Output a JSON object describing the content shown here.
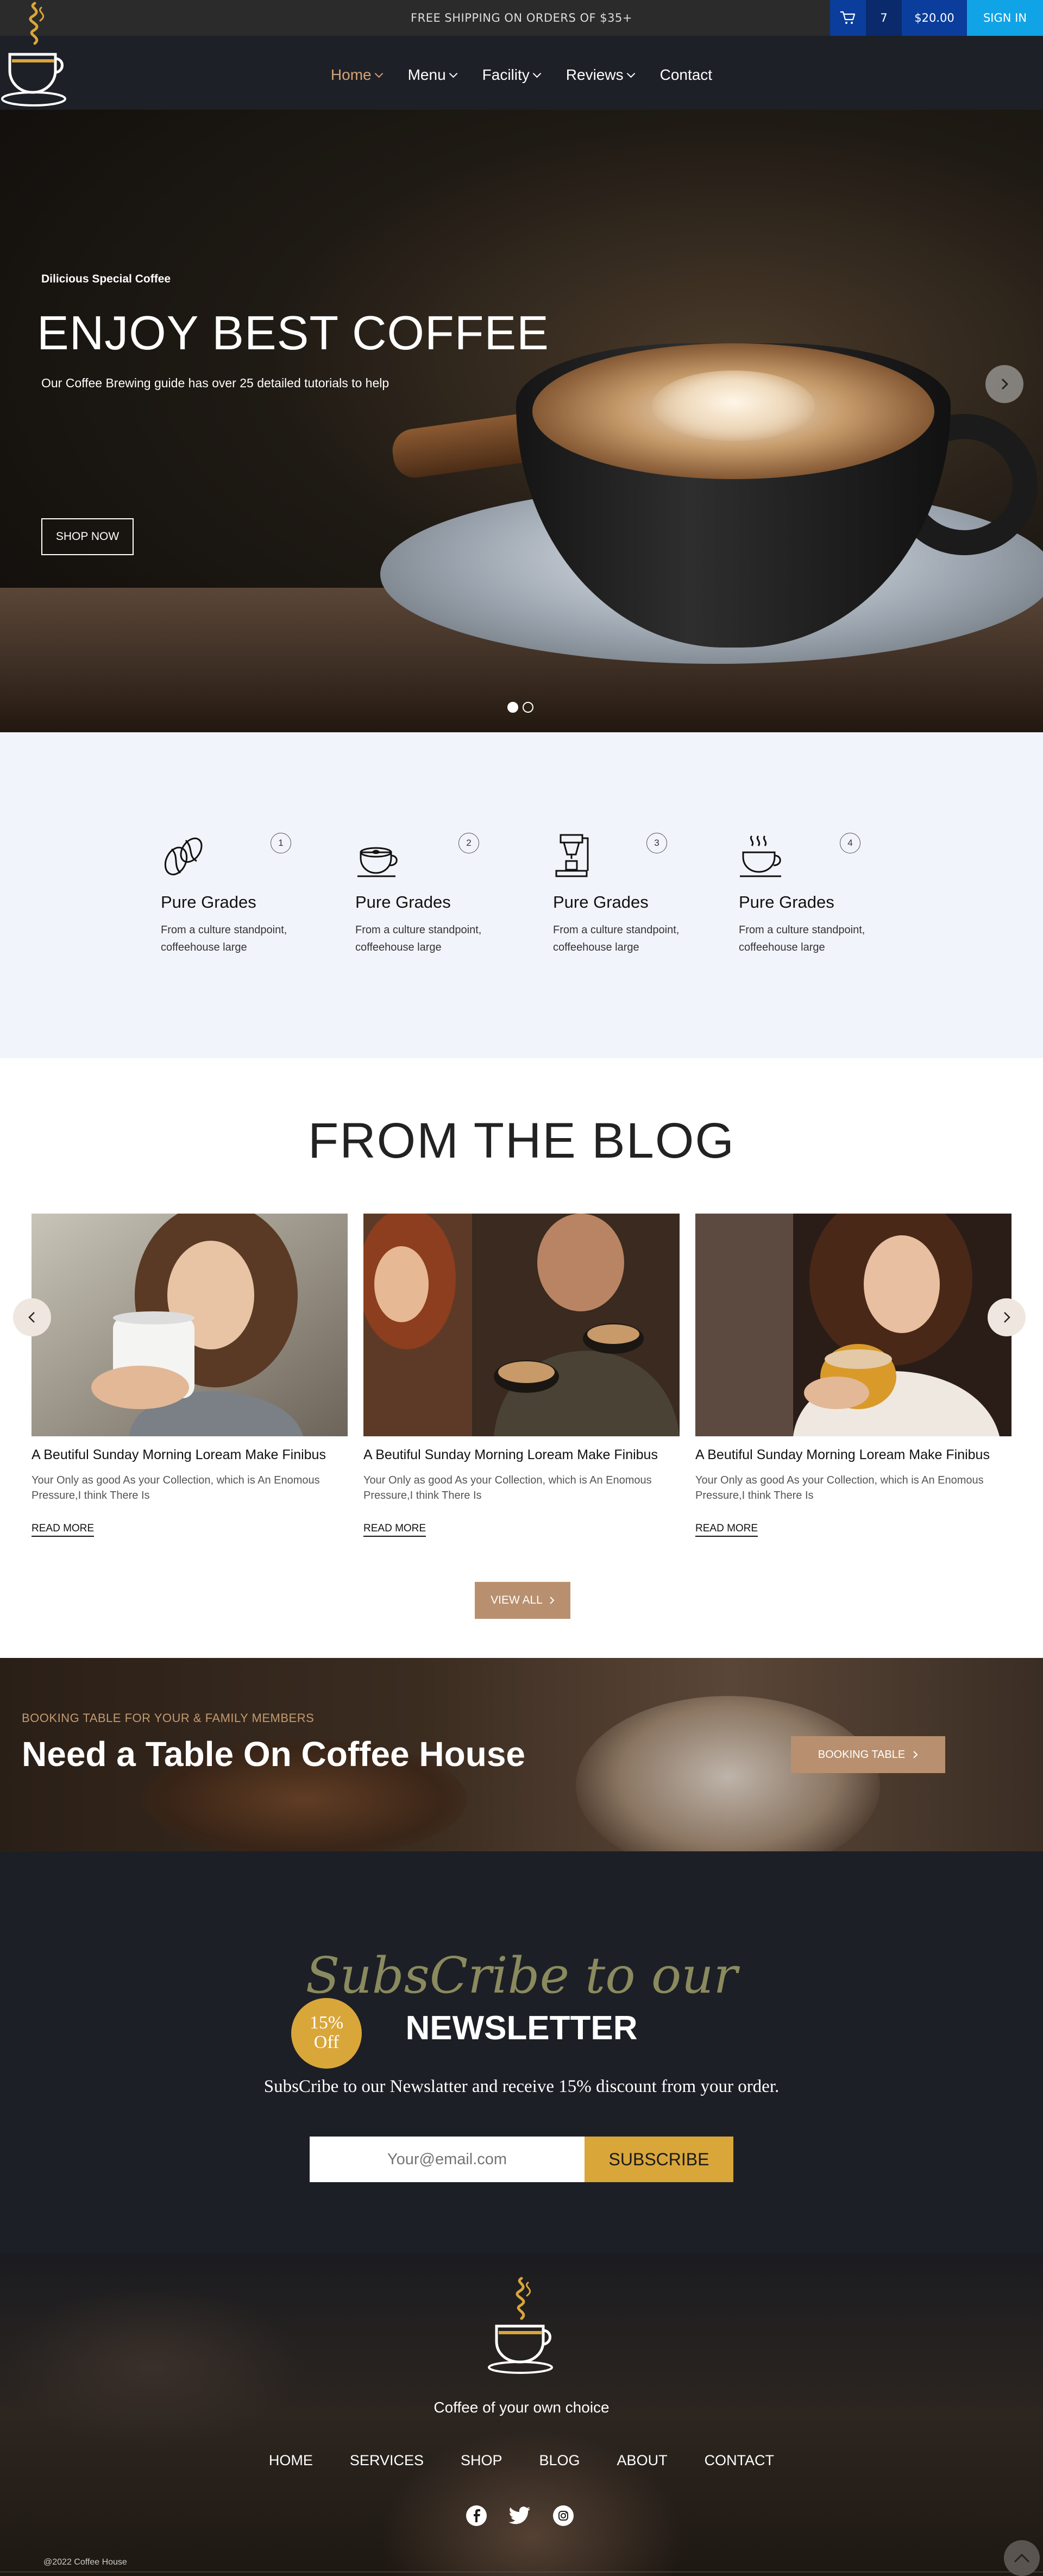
{
  "topbar": {
    "shipping": "FREE SHIPPING ON ORDERS OF $35+",
    "cart_count": "7",
    "cart_total": "$20.00",
    "signin": "SIGN IN",
    "colors": {
      "cart_bg": "#0b3d9c",
      "signin_bg": "#10a3e6"
    }
  },
  "nav": {
    "items": [
      {
        "label": "Home",
        "dropdown": true,
        "active": true
      },
      {
        "label": "Menu",
        "dropdown": true
      },
      {
        "label": "Facility",
        "dropdown": true
      },
      {
        "label": "Reviews",
        "dropdown": true
      },
      {
        "label": "Contact",
        "dropdown": false
      }
    ],
    "active_color": "#d6a276"
  },
  "hero": {
    "subtitle": "Dilicious Special  Coffee",
    "title": "ENJOY BEST COFFEE",
    "description": "Our Coffee Brewing guide has over 25 detailed tutorials to help",
    "button": "SHOP NOW",
    "slides": 2,
    "active_slide": 1
  },
  "features": [
    {
      "num": "1",
      "icon": "coffee-beans-icon",
      "title": "Pure Grades",
      "text": "From a culture standpoint, coffeehouse large"
    },
    {
      "num": "2",
      "icon": "latte-cup-icon",
      "title": "Pure Grades",
      "text": "From a culture standpoint, coffeehouse large"
    },
    {
      "num": "3",
      "icon": "coffee-machine-icon",
      "title": "Pure Grades",
      "text": "From a culture standpoint, coffeehouse large"
    },
    {
      "num": "4",
      "icon": "hot-cup-icon",
      "title": "Pure Grades",
      "text": "From a culture standpoint, coffeehouse large"
    }
  ],
  "blog": {
    "title": "FROM THE BLOG",
    "posts": [
      {
        "title": "A Beutiful Sunday Morning Loream Make Finibus",
        "desc": "Your Only as good As your Collection, which is An Enomous Pressure,I think There Is",
        "read_more": "READ MORE"
      },
      {
        "title": "A Beutiful Sunday Morning Loream Make Finibus",
        "desc": "Your Only as good As your Collection, which is An Enomous Pressure,I think There Is",
        "read_more": "READ MORE"
      },
      {
        "title": "A Beutiful Sunday Morning Loream Make Finibus",
        "desc": "Your Only as good As your Collection, which is An Enomous Pressure,I think There Is",
        "read_more": "READ MORE"
      }
    ],
    "view_all": "VIEW ALL"
  },
  "booking": {
    "subtitle": "BOOKING TABLE FOR YOUR & FAMILY MEMBERS",
    "title": "Need a Table On Coffee House",
    "button": "BOOKING TABLE"
  },
  "newsletter": {
    "script": "SubsCribe to our",
    "heading": "NEWSLETTER",
    "badge_pct": "15%",
    "badge_off": "Off",
    "description": "SubsCribe to our Newslatter and receive 15% discount from your order.",
    "placeholder": "Your@email.com",
    "button": "SUBSCRIBE",
    "accent": "#d9a63a"
  },
  "footer": {
    "tagline": "Coffee of your own choice",
    "links": [
      "HOME",
      "SERVICES",
      "SHOP",
      "BLOG",
      "ABOUT",
      "CONTACT"
    ],
    "social": [
      "facebook-icon",
      "twitter-icon",
      "instagram-icon"
    ],
    "copyright": "@2022 Coffee House"
  }
}
